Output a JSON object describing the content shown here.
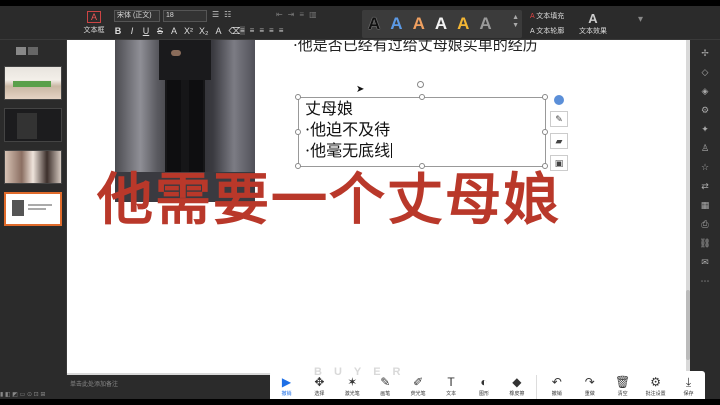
{
  "ribbon": {
    "textbox_label": "文本框",
    "font_name": "宋体 (正文)",
    "font_size": "18",
    "format_icons": [
      "B",
      "I",
      "U",
      "S",
      "A",
      "X²",
      "X₂",
      "A",
      "⌫"
    ],
    "style_letter": "A",
    "text_fill": "文本填充",
    "text_outline": "文本轮廓",
    "text_effect": "文本效果"
  },
  "slide": {
    "top_text": "·他是否已经有过给丈母娘买单的经历",
    "textbox_lines": [
      "丈母娘",
      "·他迫不及待",
      "·他毫无底线"
    ],
    "caption": "他需要一个丈母娘"
  },
  "status": {
    "note": "单击此处添加备注"
  },
  "pen_tools": [
    {
      "icon": "▶",
      "label": "撤销"
    },
    {
      "icon": "✥",
      "label": "选择"
    },
    {
      "icon": "✶",
      "label": "激光笔"
    },
    {
      "icon": "✎",
      "label": "画笔"
    },
    {
      "icon": "✐",
      "label": "荧光笔"
    },
    {
      "icon": "T",
      "label": "文本"
    },
    {
      "icon": "◐",
      "label": "图形"
    },
    {
      "icon": "◆",
      "label": "橡皮擦"
    },
    {
      "icon": "↶",
      "label": "撤销"
    },
    {
      "icon": "↷",
      "label": "重做"
    },
    {
      "icon": "🗑",
      "label": "清空"
    },
    {
      "icon": "⚙",
      "label": "批注设置"
    },
    {
      "icon": "⤓",
      "label": "保存"
    }
  ],
  "watermark": "BUYER",
  "colors": {
    "caption": "#b9382a",
    "accent_orange": "#e06b2b",
    "active_tool": "#1e6fe6"
  }
}
